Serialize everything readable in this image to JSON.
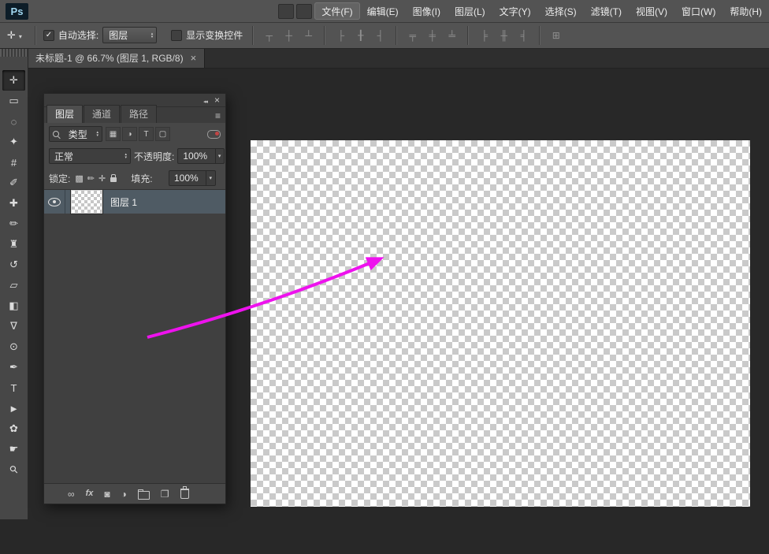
{
  "app": {
    "logo_text": "Ps",
    "menu_items": [
      {
        "label": "文件(F)",
        "active": true
      },
      {
        "label": "编辑(E)"
      },
      {
        "label": "图像(I)"
      },
      {
        "label": "图层(L)"
      },
      {
        "label": "文字(Y)"
      },
      {
        "label": "选择(S)"
      },
      {
        "label": "滤镜(T)"
      },
      {
        "label": "视图(V)"
      },
      {
        "label": "窗口(W)"
      },
      {
        "label": "帮助(H)"
      }
    ]
  },
  "options_bar": {
    "tool_icon_glyph": "✛",
    "auto_select": {
      "checked": true,
      "label": "自动选择:",
      "value": "图层"
    },
    "show_transform": {
      "checked": false,
      "label": "显示变换控件"
    },
    "align_group_1": [
      {
        "name": "align-top-edges-icon",
        "glyph": "┬"
      },
      {
        "name": "align-vertical-centers-icon",
        "glyph": "┼"
      },
      {
        "name": "align-bottom-edges-icon",
        "glyph": "┴"
      }
    ],
    "align_group_2": [
      {
        "name": "align-left-edges-icon",
        "glyph": "├"
      },
      {
        "name": "align-horizontal-centers-icon",
        "glyph": "╂"
      },
      {
        "name": "align-right-edges-icon",
        "glyph": "┤"
      }
    ],
    "distribute_group_1": [
      {
        "name": "distribute-top-edges-icon",
        "glyph": "╤"
      },
      {
        "name": "distribute-vertical-centers-icon",
        "glyph": "╪"
      },
      {
        "name": "distribute-bottom-edges-icon",
        "glyph": "╧"
      }
    ],
    "distribute_group_2": [
      {
        "name": "distribute-left-edges-icon",
        "glyph": "╞"
      },
      {
        "name": "distribute-horizontal-centers-icon",
        "glyph": "╫"
      },
      {
        "name": "distribute-right-edges-icon",
        "glyph": "╡"
      }
    ],
    "auto_align_glyph": "⊞"
  },
  "document_tab": {
    "title": "未标题-1 @ 66.7% (图层 1, RGB/8)",
    "close_glyph": "×"
  },
  "toolbar": {
    "tools": [
      {
        "name": "move-tool",
        "glyph": "✛",
        "selected": true
      },
      {
        "name": "rectangular-marquee-tool",
        "glyph": "▭"
      },
      {
        "name": "lasso-tool",
        "glyph": "◌"
      },
      {
        "name": "quick-selection-tool",
        "glyph": "✦"
      },
      {
        "name": "crop-tool",
        "glyph": "#"
      },
      {
        "name": "eyedropper-tool",
        "glyph": "✐"
      },
      {
        "name": "healing-brush-tool",
        "glyph": "✚"
      },
      {
        "name": "brush-tool",
        "glyph": "✏"
      },
      {
        "name": "clone-stamp-tool",
        "glyph": "♜"
      },
      {
        "name": "history-brush-tool",
        "glyph": "↺"
      },
      {
        "name": "eraser-tool",
        "glyph": "▱"
      },
      {
        "name": "gradient-tool",
        "glyph": "◧"
      },
      {
        "name": "blur-tool",
        "glyph": "∇"
      },
      {
        "name": "dodge-tool",
        "glyph": "⊙"
      },
      {
        "name": "pen-tool",
        "glyph": "✒"
      },
      {
        "name": "type-tool",
        "glyph": "T"
      },
      {
        "name": "path-selection-tool",
        "glyph": "►"
      },
      {
        "name": "custom-shape-tool",
        "glyph": "✿"
      },
      {
        "name": "hand-tool",
        "glyph": "☛"
      },
      {
        "name": "zoom-tool",
        "glyph": "⚲",
        "cls": "rot45"
      }
    ]
  },
  "layers_panel": {
    "tabs": [
      {
        "label": "图层",
        "active": true
      },
      {
        "label": "通道"
      },
      {
        "label": "路径"
      }
    ],
    "filter": {
      "label": "类型",
      "icons": [
        {
          "name": "filter-pixel-layers-icon",
          "glyph": "▦"
        },
        {
          "name": "filter-adjustment-layers-icon",
          "glyph": "◑"
        },
        {
          "name": "filter-type-layers-icon",
          "glyph": "T"
        },
        {
          "name": "filter-shape-layers-icon",
          "glyph": "▢"
        }
      ]
    },
    "blend_mode": "正常",
    "opacity": {
      "label": "不透明度:",
      "value": "100%"
    },
    "lock": {
      "label": "锁定:",
      "icons": [
        {
          "name": "lock-transparent-pixels-icon",
          "glyph": "▩"
        },
        {
          "name": "lock-image-pixels-icon",
          "glyph": "✏"
        },
        {
          "name": "lock-position-icon",
          "glyph": "✛"
        }
      ]
    },
    "fill": {
      "label": "填充:",
      "value": "100%"
    },
    "layers": [
      {
        "layer_name": "图层 1",
        "selected": true,
        "visible": true
      }
    ],
    "bottom_bar": {
      "link_glyph": "∞",
      "fx_label": "fx",
      "mask_glyph": "◙",
      "adjustment_glyph": "◑",
      "new_layer_glyph": "❐"
    }
  },
  "annotation": {
    "color": "#ee12ee"
  },
  "colors": {
    "chrome": "#535353",
    "panel": "#474747",
    "workspace": "#282828",
    "selection": "#4f5b64"
  }
}
